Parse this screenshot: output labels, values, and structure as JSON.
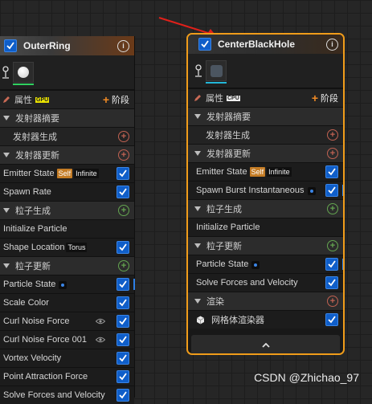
{
  "colors": {
    "accent_orange": "#f09c1a",
    "checkbox_blue": "#0f5ec9",
    "plus_red": "#c06252",
    "plus_green": "#64a550",
    "arrow_red": "#e0201a"
  },
  "outer_ring": {
    "title": "OuterRing",
    "thumb_color": "#30d060",
    "props_label": "属性",
    "sim_badge": "GPU",
    "stage_label": "阶段",
    "rows": {
      "emitter_summary": "发射器摘要",
      "emitter_spawn": "发射器生成",
      "emitter_update": "发射器更新",
      "emitter_state": "Emitter State",
      "emitter_state_tag1": "Self",
      "emitter_state_tag2": "Infinite",
      "spawn_rate": "Spawn Rate",
      "particle_spawn": "粒子生成",
      "initialize_particle": "Initialize Particle",
      "shape_location": "Shape Location",
      "shape_location_tag": "Torus",
      "particle_update": "粒子更新",
      "particle_state": "Particle State",
      "scale_color": "Scale Color",
      "curl_noise_force": "Curl Noise Force",
      "curl_noise_force_001": "Curl Noise Force 001",
      "vortex_velocity": "Vortex Velocity",
      "point_attraction_force": "Point Attraction Force",
      "solve_forces": "Solve Forces and Velocity"
    }
  },
  "center_black_hole": {
    "title": "CenterBlackHole",
    "thumb_color": "#22b6d8",
    "props_label": "属性",
    "sim_badge": "CPU",
    "stage_label": "阶段",
    "rows": {
      "emitter_summary": "发射器摘要",
      "emitter_spawn": "发射器生成",
      "emitter_update": "发射器更新",
      "emitter_state": "Emitter State",
      "emitter_state_tag1": "Self",
      "emitter_state_tag2": "Infinite",
      "spawn_burst": "Spawn Burst Instantaneous",
      "particle_spawn": "粒子生成",
      "initialize_particle": "Initialize Particle",
      "particle_update": "粒子更新",
      "particle_state": "Particle State",
      "solve_forces": "Solve Forces and Velocity",
      "render": "渲染",
      "mesh_renderer": "网格体渲染器"
    },
    "collapse_icon": "chevron-up-icon"
  },
  "watermark": "CSDN @Zhichao_97"
}
